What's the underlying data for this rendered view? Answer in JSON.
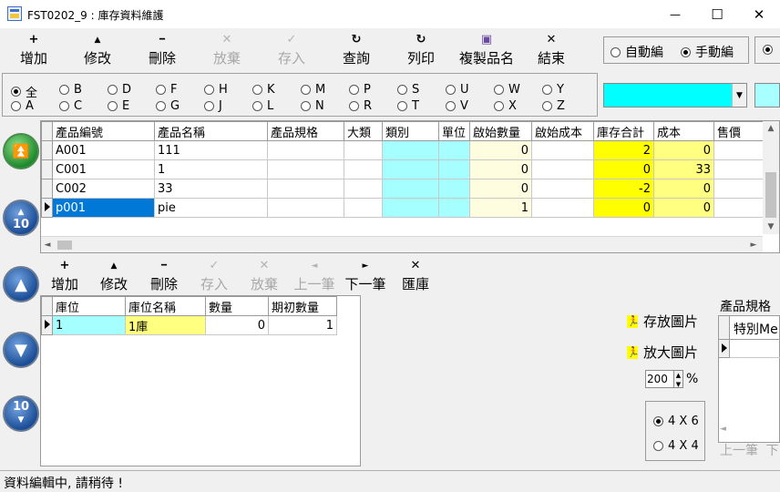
{
  "window": {
    "title": "FST0202_9 : 庫存資料維護",
    "minimize": "—",
    "maximize": "☐",
    "close": "✕"
  },
  "toolbar": {
    "add": "增加",
    "edit": "修改",
    "delete": "刪除",
    "discard": "放棄",
    "save": "存入",
    "query": "查詢",
    "print": "列印",
    "copy_name": "複製品名",
    "exit": "結束",
    "icons": {
      "add": "+",
      "edit": "▲",
      "delete": "━",
      "discard": "✕",
      "save": "✓",
      "query": "↻",
      "print": "↻",
      "copy_name": "▣",
      "exit": "✕"
    }
  },
  "numbering": {
    "auto": "自動編",
    "manual": "手動編",
    "selected": "manual"
  },
  "letters": {
    "row1": [
      "全",
      "B",
      "D",
      "F",
      "H",
      "K",
      "M",
      "P",
      "S",
      "U",
      "W",
      "Y"
    ],
    "row2": [
      "A",
      "C",
      "E",
      "G",
      "J",
      "L",
      "N",
      "R",
      "T",
      "V",
      "X",
      "Z"
    ],
    "selected": "全"
  },
  "nav": {
    "top": "top-icon",
    "prev10": "10",
    "prev": "prev-icon",
    "next": "next-icon",
    "next10": "10"
  },
  "main_grid": {
    "columns": [
      "產品編號",
      "產品名稱",
      "產品規格",
      "大類",
      "類別",
      "單位",
      "啟始數量",
      "啟始成本",
      "庫存合計",
      "成本",
      "售價"
    ],
    "rows": [
      {
        "code": "A001",
        "name": "111",
        "spec": "",
        "major": "",
        "cat": "",
        "unit": "",
        "start_qty": "0",
        "start_cost": "",
        "stock_total": "2",
        "cost": "0",
        "price": ""
      },
      {
        "code": "C001",
        "name": "1",
        "spec": "",
        "major": "",
        "cat": "",
        "unit": "",
        "start_qty": "0",
        "start_cost": "",
        "stock_total": "0",
        "cost": "33",
        "price": ""
      },
      {
        "code": "C002",
        "name": "33",
        "spec": "",
        "major": "",
        "cat": "",
        "unit": "",
        "start_qty": "0",
        "start_cost": "",
        "stock_total": "-2",
        "cost": "0",
        "price": ""
      },
      {
        "code": "p001",
        "name": "pie",
        "spec": "",
        "major": "",
        "cat": "",
        "unit": "",
        "start_qty": "1",
        "start_cost": "",
        "stock_total": "0",
        "cost": "0",
        "price": ""
      }
    ]
  },
  "sub_toolbar": {
    "add": "增加",
    "edit": "修改",
    "delete": "刪除",
    "save": "存入",
    "discard": "放棄",
    "prev": "上一筆",
    "next": "下一筆",
    "transfer": "匯庫",
    "icons": {
      "add": "+",
      "edit": "▲",
      "delete": "━",
      "save": "✓",
      "discard": "✕",
      "prev": "◄",
      "next": "►",
      "transfer": "✕"
    }
  },
  "location_grid": {
    "columns": [
      "庫位",
      "庫位名稱",
      "數量",
      "期初數量"
    ],
    "rows": [
      {
        "loc": "1",
        "loc_name": "1庫",
        "qty": "0",
        "init_qty": "1"
      }
    ]
  },
  "image_panel": {
    "store": "存放圖片",
    "enlarge": "放大圖片",
    "zoom": "200",
    "percent": "%",
    "grid_6": "4 X 6",
    "grid_4": "4 X 4",
    "selected_grid": "4 X 6"
  },
  "spec_panel": {
    "title": "產品規格",
    "column": "特別Me",
    "prev": "上一筆",
    "next": "下"
  },
  "status": {
    "message": "資料編輯中, 請稍待 !"
  },
  "colors": {
    "cyan": "#00ffff",
    "light_cyan": "#a6ffff",
    "yellow": "#ffff00",
    "pale_yellow": "#ffff80",
    "selection": "#0078d7"
  }
}
